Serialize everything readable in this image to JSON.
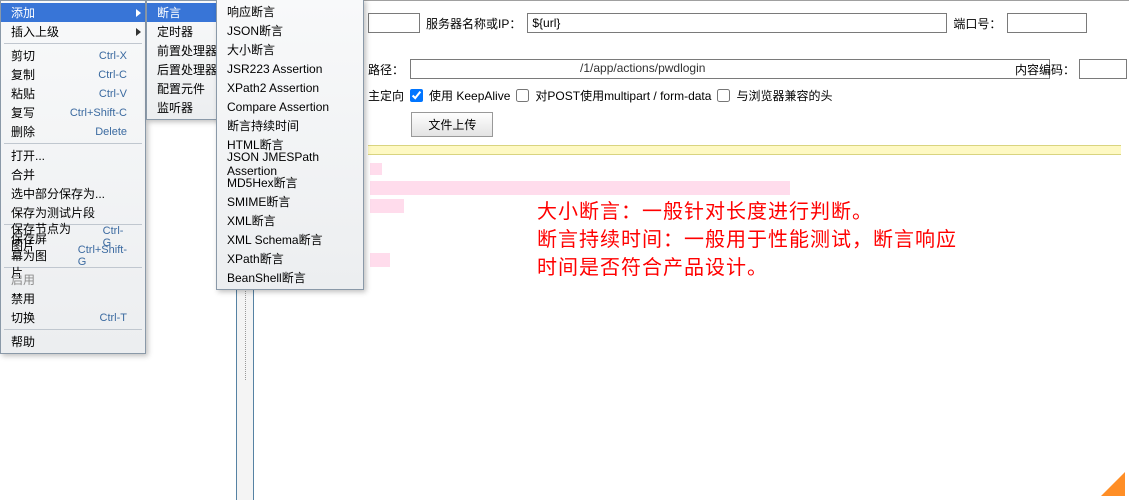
{
  "colors": {
    "highlight": "#3875d7",
    "annotation": "#ff0000"
  },
  "form": {
    "blank_label": "",
    "server_label": "服务器名称或IP：",
    "server_value": "${url}",
    "port_label": "端口号：",
    "port_value": "",
    "path_label": "路径：",
    "path_value": "/1/app/actions/pwdlogin",
    "encoding_label": "内容编码：",
    "encoding_value": "",
    "check_redirect_label": "主定向",
    "check_keepalive_label": "使用 KeepAlive",
    "check_multipart_label": "对POST使用multipart / form-data",
    "check_browser_label": "与浏览器兼容的头",
    "tab_upload": "文件上传"
  },
  "context_menu": [
    {
      "label": "添加",
      "submenu": true,
      "active": true
    },
    {
      "label": "插入上级",
      "submenu": true
    },
    {
      "sep": true
    },
    {
      "label": "剪切",
      "shortcut": "Ctrl-X"
    },
    {
      "label": "复制",
      "shortcut": "Ctrl-C"
    },
    {
      "label": "粘贴",
      "shortcut": "Ctrl-V"
    },
    {
      "label": "复写",
      "shortcut": "Ctrl+Shift-C"
    },
    {
      "label": "删除",
      "shortcut": "Delete"
    },
    {
      "sep": true
    },
    {
      "label": "打开..."
    },
    {
      "label": "合并"
    },
    {
      "label": "选中部分保存为..."
    },
    {
      "label": "保存为测试片段"
    },
    {
      "sep": true
    },
    {
      "label": "保存节点为图片",
      "shortcut": "Ctrl-G"
    },
    {
      "label": "保存屏幕为图片",
      "shortcut": "Ctrl+Shift-G"
    },
    {
      "sep": true
    },
    {
      "label": "启用",
      "disabled": true
    },
    {
      "label": "禁用"
    },
    {
      "label": "切换",
      "shortcut": "Ctrl-T"
    },
    {
      "sep": true
    },
    {
      "label": "帮助"
    }
  ],
  "add_menu": [
    {
      "label": "断言",
      "submenu": true,
      "active": true
    },
    {
      "label": "定时器",
      "submenu": true
    },
    {
      "label": "前置处理器",
      "submenu": true
    },
    {
      "label": "后置处理器",
      "submenu": true
    },
    {
      "label": "配置元件",
      "submenu": true
    },
    {
      "label": "监听器",
      "submenu": true
    }
  ],
  "assert_menu": [
    "响应断言",
    "JSON断言",
    "大小断言",
    "JSR223 Assertion",
    "XPath2 Assertion",
    "Compare Assertion",
    "断言持续时间",
    "HTML断言",
    "JSON JMESPath Assertion",
    "MD5Hex断言",
    "SMIME断言",
    "XML断言",
    "XML Schema断言",
    "XPath断言",
    "BeanShell断言"
  ],
  "annotation": {
    "line1": "大小断言：一般针对长度进行判断。",
    "line2": "断言持续时间：一般用于性能测试，断言响应",
    "line3": "时间是否符合产品设计。"
  }
}
